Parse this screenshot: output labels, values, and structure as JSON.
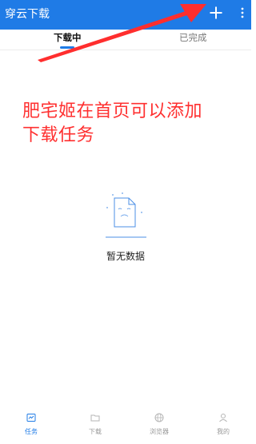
{
  "header": {
    "title": "穿云下载",
    "add_icon": "plus-icon",
    "more_icon": "more-vertical-icon",
    "background_color": "#1f7be6"
  },
  "tabs": [
    {
      "label": "下载中",
      "active": true
    },
    {
      "label": "已完成",
      "active": false
    }
  ],
  "annotation": {
    "lines": [
      "肥宅姬在首页可以添加",
      "下载任务"
    ],
    "color": "#ff3030"
  },
  "empty_state": {
    "icon": "empty-document-icon",
    "text": "暂无数据"
  },
  "bottom_nav": [
    {
      "label": "任务",
      "icon": "task-icon",
      "active": true
    },
    {
      "label": "下载",
      "icon": "folder-icon",
      "active": false
    },
    {
      "label": "浏览器",
      "icon": "browser-icon",
      "active": false
    },
    {
      "label": "我的",
      "icon": "user-icon",
      "active": false
    }
  ],
  "accent_color": "#1f7be6"
}
